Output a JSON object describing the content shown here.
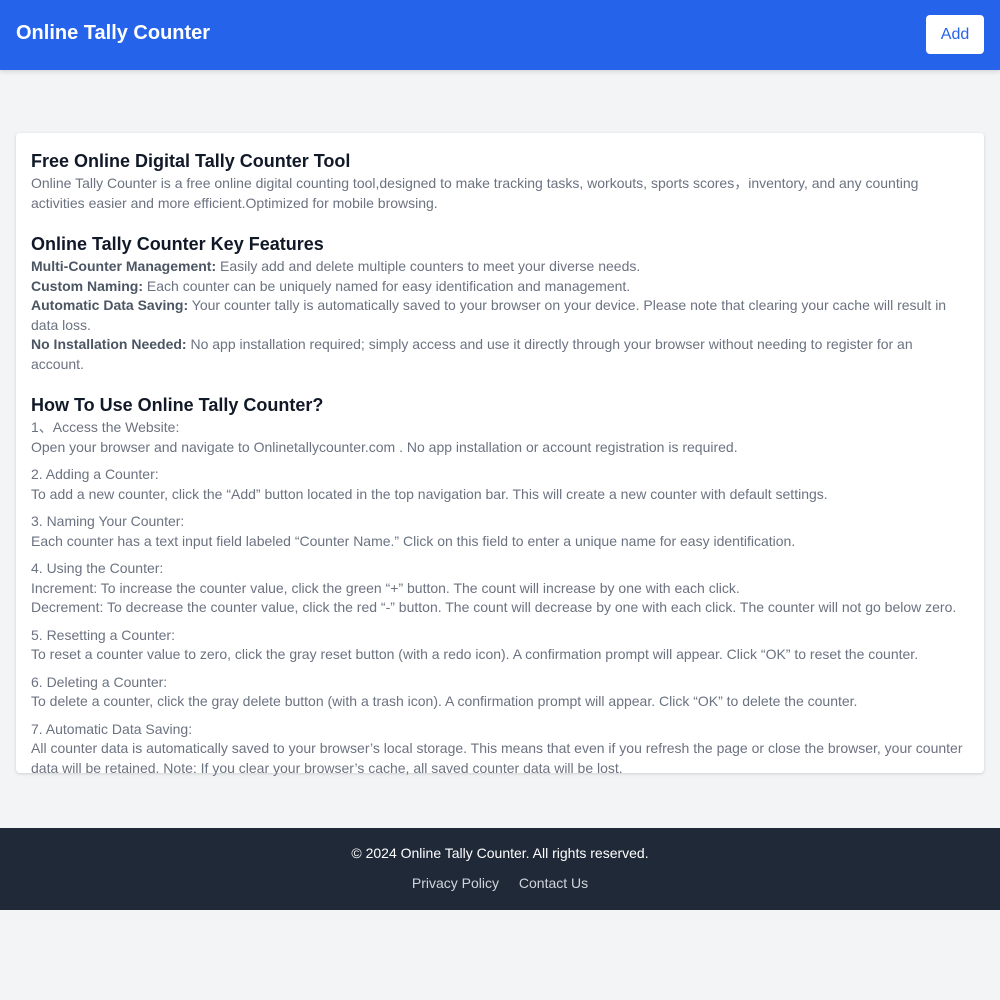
{
  "header": {
    "title": "Online Tally Counter",
    "add_label": "Add"
  },
  "intro": {
    "title": "Free Online Digital Tally Counter Tool",
    "body": "Online Tally Counter is a free online digital counting tool,designed to make tracking tasks, workouts, sports scores，inventory, and any counting activities easier and more efficient.Optimized for mobile browsing."
  },
  "features": {
    "title": "Online Tally Counter Key Features",
    "items": [
      {
        "label": "Multi-Counter Management:",
        "text": "Easily add and delete multiple counters to meet your diverse needs."
      },
      {
        "label": "Custom Naming:",
        "text": "Each counter can be uniquely named for easy identification and management."
      },
      {
        "label": "Automatic Data Saving:",
        "text": "Your counter tally is automatically saved to your browser on your device. Please note that clearing your cache will result in data loss."
      },
      {
        "label": "No Installation Needed:",
        "text": "No app installation required; simply access and use it directly through your browser without needing to register for an account."
      }
    ]
  },
  "howto": {
    "title": "How To Use Online Tally Counter?",
    "steps": [
      {
        "heading": "1、Access the Website:",
        "lines": [
          "Open your browser and navigate to Onlinetallycounter.com . No app installation or account registration is required."
        ]
      },
      {
        "heading": "2. Adding a Counter:",
        "lines": [
          "To add a new counter, click the “Add” button located in the top navigation bar. This will create a new counter with default settings."
        ]
      },
      {
        "heading": "3. Naming Your Counter:",
        "lines": [
          "Each counter has a text input field labeled “Counter Name.” Click on this field to enter a unique name for easy identification."
        ]
      },
      {
        "heading": "4. Using the Counter:",
        "lines": [
          "Increment: To increase the counter value, click the green “+” button. The count will increase by one with each click.",
          "Decrement: To decrease the counter value, click the red “-” button. The count will decrease by one with each click. The counter will not go below zero."
        ]
      },
      {
        "heading": "5. Resetting a Counter:",
        "lines": [
          "To reset a counter value to zero, click the gray reset button (with a redo icon). A confirmation prompt will appear. Click “OK” to reset the counter."
        ]
      },
      {
        "heading": "6. Deleting a Counter:",
        "lines": [
          "To delete a counter, click the gray delete button (with a trash icon). A confirmation prompt will appear. Click “OK” to delete the counter."
        ]
      },
      {
        "heading": "7. Automatic Data Saving:",
        "lines": [
          "All counter data is automatically saved to your browser’s local storage. This means that even if you refresh the page or close the browser, your counter data will be retained. Note: If you clear your browser’s cache, all saved counter data will be lost."
        ]
      }
    ]
  },
  "footer": {
    "copyright": "© 2024 Online Tally Counter. All rights reserved.",
    "links": [
      "Privacy Policy",
      "Contact Us"
    ]
  }
}
